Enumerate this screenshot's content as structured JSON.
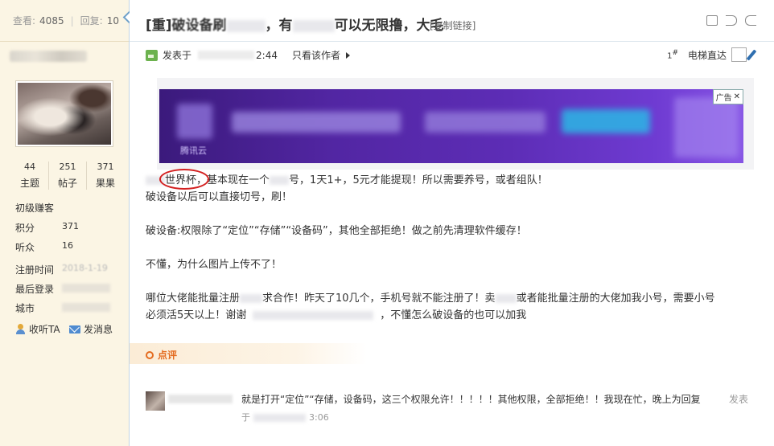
{
  "sidebar": {
    "stats": {
      "views_label": "查看:",
      "views_value": "4085",
      "replies_label": "回复:",
      "replies_value": "10"
    },
    "counts": [
      {
        "num": "44",
        "label": "主题"
      },
      {
        "num": "251",
        "label": "帖子"
      },
      {
        "num": "371",
        "label": "果果"
      }
    ],
    "level": "初级赚客",
    "info": {
      "points_label": "积分",
      "points_value": "371",
      "listeners_label": "听众",
      "listeners_value": "16",
      "register_label": "注册时间",
      "register_value": "2018-1-19",
      "last_login_label": "最后登录",
      "city_label": "城市"
    },
    "actions": {
      "follow": "收听TA",
      "message": "发消息"
    }
  },
  "post": {
    "title_prefix": "[重]",
    "title_part1": "破设备刷",
    "title_part2": "，有",
    "title_part3": "可以无限撸，大毛",
    "copy_link": "[复制链接]",
    "meta": {
      "posted_label": "发表于",
      "time_tail": "2:44",
      "only_author": "只看该作者"
    },
    "floor": {
      "floor_num": "1",
      "floor_sup": "#",
      "elevator_label": "电梯直达"
    },
    "ad": {
      "tag": "广告",
      "brand": "腾讯云"
    },
    "body": {
      "line1_circled": "世界杯",
      "line1_a": "基本现在一个",
      "line1_b": "号，1天1+，5元才能提现！所以需要养号，或者组队！",
      "line2": "破设备以后可以直接切号，刷！",
      "line3": "破设备:权限除了“定位”“存储”“设备码”，其他全部拒绝！做之前先清理软件缓存！",
      "line4": "不懂，为什么图片上传不了！",
      "line5_a": "哪位大佬能批量注册",
      "line5_b": "求合作！昨天了10几个，手机号就不能注册了！卖",
      "line5_c": "或者能批量注册的大佬加我小号，需要小号",
      "line6_a": "必须活5天以上！谢谢",
      "line6_b": "，不懂怎么破设备的也可以加我"
    }
  },
  "review": {
    "label": "点评"
  },
  "comment": {
    "text": "就是打开“定位”“存储，设备码，这三个权限允许！！！！！其他权限，全部拒绝！！我现在忙，晚上为回复",
    "post_label": "发表",
    "time_prefix": "于",
    "time_tail": "3:06"
  },
  "colors": {
    "sidebar_bg": "#fbf5e4",
    "accent_orange": "#e46b1f",
    "ad_purple": "#5226a3",
    "circle_red": "#d32020"
  }
}
